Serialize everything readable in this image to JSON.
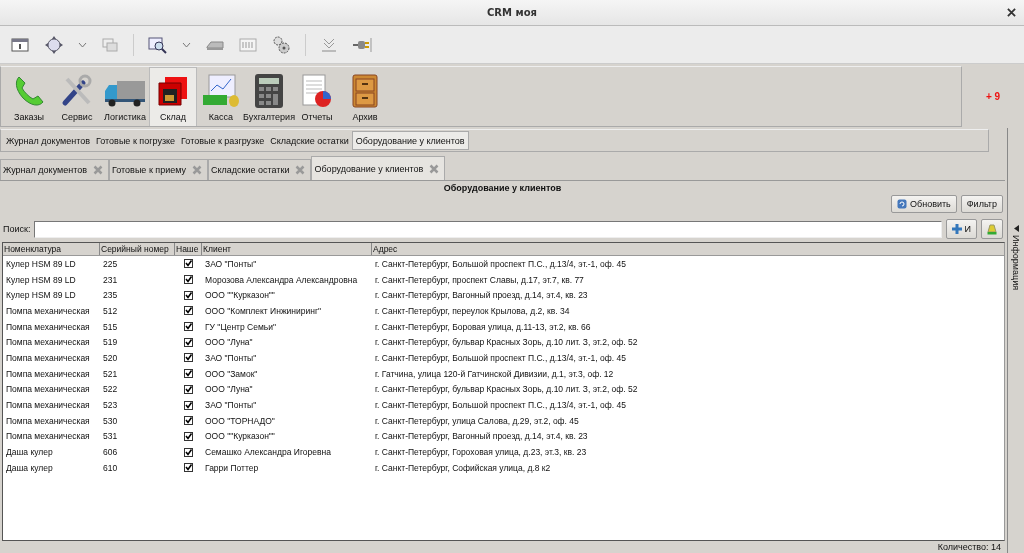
{
  "window": {
    "title": "CRM моя"
  },
  "toolbar": [
    {
      "kind": "window"
    },
    {
      "kind": "move"
    },
    {
      "kind": "caret"
    },
    {
      "kind": "windows"
    },
    {
      "kind": "sep"
    },
    {
      "kind": "search"
    },
    {
      "kind": "caret"
    },
    {
      "kind": "scanner"
    },
    {
      "kind": "panel"
    },
    {
      "kind": "gears"
    },
    {
      "kind": "sep"
    },
    {
      "kind": "tray"
    },
    {
      "kind": "plug"
    }
  ],
  "modules": [
    {
      "label": "Заказы",
      "selected": false
    },
    {
      "label": "Сервис",
      "selected": false
    },
    {
      "label": "Логистика",
      "selected": false
    },
    {
      "label": "Склад",
      "selected": true
    },
    {
      "label": "Касса",
      "selected": false
    },
    {
      "label": "Бухгалтерия",
      "selected": false
    },
    {
      "label": "Отчеты",
      "selected": false
    },
    {
      "label": "Архив",
      "selected": false
    }
  ],
  "badge": "+ 9",
  "subtabs": [
    {
      "label": "Журнал документов",
      "selected": false
    },
    {
      "label": "Готовые к погрузке",
      "selected": false
    },
    {
      "label": "Готовые к разгрузке",
      "selected": false
    },
    {
      "label": "Складские остатки",
      "selected": false
    },
    {
      "label": "Оборудование у клиентов",
      "selected": true
    }
  ],
  "doc_tabs": [
    {
      "label": "Журнал документов",
      "selected": false
    },
    {
      "label": "Готовые к приему",
      "selected": false
    },
    {
      "label": "Складские остатки",
      "selected": false
    },
    {
      "label": "Оборудование у клиентов",
      "selected": true
    }
  ],
  "panel": {
    "title": "Оборудование у клиентов",
    "refresh_button": "Обновить",
    "filter_button": "Фильтр",
    "search_label": "Поиск:",
    "add_button": "И"
  },
  "table": {
    "columns": [
      "Номенклатура",
      "Серийный номер",
      "Наше",
      "Клиент",
      "Адрес"
    ],
    "rows": [
      {
        "item": "Кулер HSM 89 LD",
        "serial": "225",
        "ours": true,
        "client": "ЗАО \"Понты\"",
        "address": "г. Санкт-Петербург, Большой проспект П.С., д.13/4, эт.-1, оф. 45"
      },
      {
        "item": "Кулер HSM 89 LD",
        "serial": "231",
        "ours": true,
        "client": "Морозова Александра Александровна",
        "address": "г. Санкт-Петербург, проспект Славы, д.17, эт.7, кв. 77"
      },
      {
        "item": "Кулер HSM 89 LD",
        "serial": "235",
        "ours": true,
        "client": "ООО \"\"Курказон\"\"",
        "address": "г. Санкт-Петербург, Вагонный проезд, д.14, эт.4, кв. 23"
      },
      {
        "item": "Помпа механическая",
        "serial": "512",
        "ours": true,
        "client": "ООО \"Комплект Инжиниринг\"",
        "address": "г. Санкт-Петербург, переулок Крылова, д.2, кв. 34"
      },
      {
        "item": "Помпа механическая",
        "serial": "515",
        "ours": true,
        "client": "ГУ \"Центр Семьи\"",
        "address": "г. Санкт-Петербург, Боровая улица, д.11-13, эт.2, кв. 66"
      },
      {
        "item": "Помпа механическая",
        "serial": "519",
        "ours": true,
        "client": "ООО \"Луна\"",
        "address": "г. Санкт-Петербург, бульвар Красных Зорь, д.10 лит. З, эт.2, оф. 52"
      },
      {
        "item": "Помпа механическая",
        "serial": "520",
        "ours": true,
        "client": "ЗАО \"Понты\"",
        "address": "г. Санкт-Петербург, Большой проспект П.С., д.13/4, эт.-1, оф. 45"
      },
      {
        "item": "Помпа механическая",
        "serial": "521",
        "ours": true,
        "client": "ООО \"Замок\"",
        "address": "г. Гатчина, улица 120-й Гатчинской Дивизии, д.1, эт.3, оф. 12"
      },
      {
        "item": "Помпа механическая",
        "serial": "522",
        "ours": true,
        "client": "ООО \"Луна\"",
        "address": "г. Санкт-Петербург, бульвар Красных Зорь, д.10 лит. З, эт.2, оф. 52"
      },
      {
        "item": "Помпа механическая",
        "serial": "523",
        "ours": true,
        "client": "ЗАО \"Понты\"",
        "address": "г. Санкт-Петербург, Большой проспект П.С., д.13/4, эт.-1, оф. 45"
      },
      {
        "item": "Помпа механическая",
        "serial": "530",
        "ours": true,
        "client": "ООО \"ТОРНАДО\"",
        "address": "г. Санкт-Петербург, улица Салова, д.29, эт.2, оф. 45"
      },
      {
        "item": "Помпа механическая",
        "serial": "531",
        "ours": true,
        "client": "ООО \"\"Курказон\"\"",
        "address": "г. Санкт-Петербург, Вагонный проезд, д.14, эт.4, кв. 23"
      },
      {
        "item": "Даша кулер",
        "serial": "606",
        "ours": true,
        "client": "Семашко Александра Игоревна",
        "address": "г. Санкт-Петербург, Гороховая улица, д.23, эт.3, кв. 23"
      },
      {
        "item": "Даша кулер",
        "serial": "610",
        "ours": true,
        "client": "Гарри Поттер",
        "address": "г. Санкт-Петербург, Софийская улица, д.8 к2"
      }
    ]
  },
  "side_panel": {
    "label": "Информация"
  },
  "status_bar": {
    "count": "Количество: 14"
  }
}
